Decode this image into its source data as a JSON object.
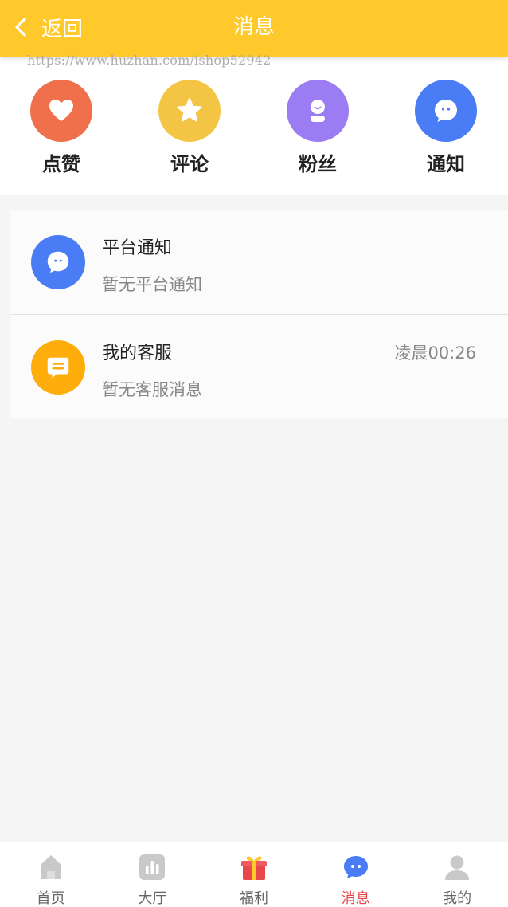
{
  "header": {
    "back_label": "返回",
    "title": "消息",
    "bg_color": "#ffc92b"
  },
  "watermark": "https://www.huzhan.com/ishop52942",
  "quick_actions": [
    {
      "label": "点赞",
      "icon": "heart-icon",
      "color": "#f0704b"
    },
    {
      "label": "评论",
      "icon": "star-icon",
      "color": "#f4c545"
    },
    {
      "label": "粉丝",
      "icon": "person-icon",
      "color": "#9b7cf3"
    },
    {
      "label": "通知",
      "icon": "chat-bubble-icon",
      "color": "#4a7cf6"
    }
  ],
  "messages": [
    {
      "name": "平台通知",
      "subtitle": "暂无平台通知",
      "time": "",
      "icon": "chat-bubble-icon",
      "color": "#4a7cf6"
    },
    {
      "name": "我的客服",
      "subtitle": "暂无客服消息",
      "time": "凌晨00:26",
      "icon": "message-lines-icon",
      "color": "#ffad0a"
    }
  ],
  "tabs": [
    {
      "label": "首页",
      "icon": "home-icon"
    },
    {
      "label": "大厅",
      "icon": "hall-icon"
    },
    {
      "label": "福利",
      "icon": "gift-icon"
    },
    {
      "label": "消息",
      "icon": "message-icon",
      "active": true
    },
    {
      "label": "我的",
      "icon": "user-icon"
    }
  ],
  "colors": {
    "active_tab": "#e8474b",
    "inactive_icon": "#c9c9c9"
  }
}
